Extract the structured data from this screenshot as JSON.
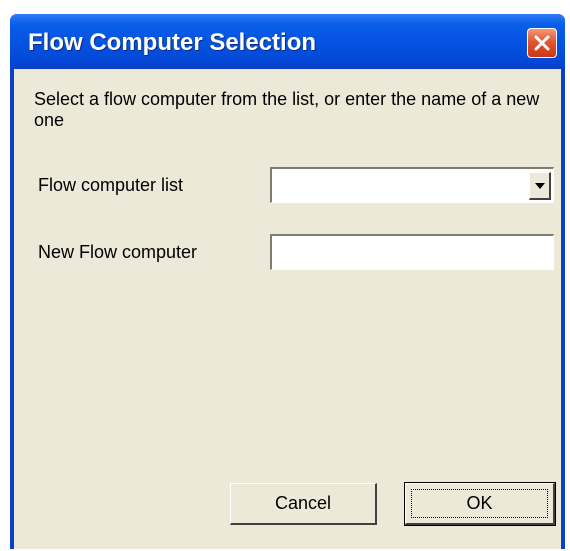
{
  "window": {
    "title": "Flow Computer Selection"
  },
  "dialog": {
    "instruction": "Select a flow computer from the list, or enter the name of a new one",
    "flow_computer_list_label": "Flow computer list",
    "flow_computer_list_value": "",
    "new_flow_computer_label": "New Flow computer",
    "new_flow_computer_value": "",
    "cancel_label": "Cancel",
    "ok_label": "OK"
  },
  "icons": {
    "close": "close-icon",
    "dropdown": "chevron-down-icon"
  },
  "colors": {
    "titlebar": "#0452e0",
    "client_bg": "#ece9d8",
    "close_button": "#e2572f"
  }
}
